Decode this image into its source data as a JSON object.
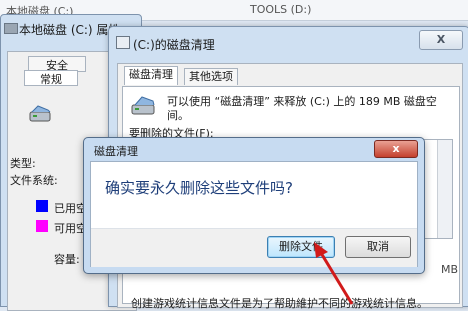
{
  "background": {
    "left_text": "本地磁盘 (C:)",
    "right_text": "TOOLS (D:)"
  },
  "properties": {
    "title": "本地磁盘 (C:) 属性",
    "tabs": [
      "安全",
      "常规"
    ],
    "type_label": "类型:",
    "fs_label": "文件系统:",
    "used_label": "已用空",
    "free_label": "可用空",
    "capacity_label": "容量:",
    "used_color": "#0000ff",
    "free_color": "#ff00ff"
  },
  "cleanup": {
    "title": "(C:)的磁盘清理",
    "close": "X",
    "tabs": [
      "磁盘清理",
      "其他选项"
    ],
    "intro": "可以使用 “磁盘清理” 来释放  (C:) 上的 189 MB 磁盘空间。",
    "delete_label": "要删除的文件(F):",
    "size_fragment": "MB",
    "description": "创建游戏统计信息文件是为了帮助維护不同的游戏统计信息。"
  },
  "confirm": {
    "title": "磁盘清理",
    "close": "x",
    "message": "确实要永久删除这些文件吗?",
    "delete_button": "删除文件",
    "cancel_button": "取消"
  },
  "icons": {
    "disk": "disk-drive-icon",
    "cleanup": "cleanup-icon",
    "arrow": "red-arrow-icon"
  },
  "colors": {
    "arrow": "#d11a1a",
    "title_text": "#1f3f7a"
  }
}
